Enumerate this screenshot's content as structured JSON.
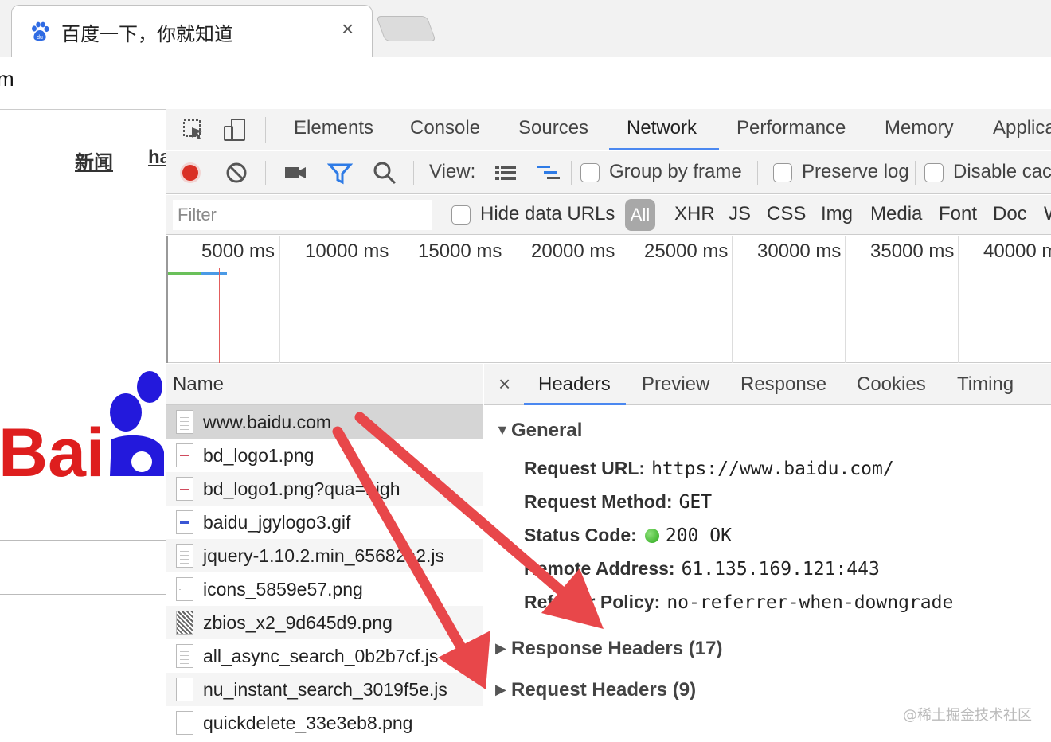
{
  "browser": {
    "tab_title": "百度一下，你就知道",
    "tab_close": "×",
    "address_text": "m"
  },
  "page": {
    "nav_news": "新闻",
    "nav_hao": "ha",
    "logo_text": "Bai"
  },
  "devtools": {
    "tabs": [
      "Elements",
      "Console",
      "Sources",
      "Network",
      "Performance",
      "Memory",
      "Applica"
    ],
    "active_tab": "Network",
    "toolbar": {
      "view_label": "View:",
      "group_by_frame": "Group by frame",
      "preserve_log": "Preserve log",
      "disable_cache": "Disable cac"
    },
    "filter": {
      "placeholder": "Filter",
      "hide_data_urls": "Hide data URLs",
      "types": [
        "All",
        "XHR",
        "JS",
        "CSS",
        "Img",
        "Media",
        "Font",
        "Doc",
        "W"
      ]
    },
    "timeline_ticks": [
      "5000 ms",
      "10000 ms",
      "15000 ms",
      "20000 ms",
      "25000 ms",
      "30000 ms",
      "35000 ms",
      "40000 m"
    ],
    "name_header": "Name",
    "requests": [
      "www.baidu.com",
      "bd_logo1.png",
      "bd_logo1.png?qua=high",
      "baidu_jgylogo3.gif",
      "jquery-1.10.2.min_65682a2.js",
      "icons_5859e57.png",
      "zbios_x2_9d645d9.png",
      "all_async_search_0b2b7cf.js",
      "nu_instant_search_3019f5e.js",
      "quickdelete_33e3eb8.png"
    ],
    "selected_request": "www.baidu.com",
    "detail": {
      "close": "×",
      "tabs": [
        "Headers",
        "Preview",
        "Response",
        "Cookies",
        "Timing"
      ],
      "active_tab": "Headers",
      "general_title": "General",
      "general": [
        {
          "key": "Request URL:",
          "value": "https://www.baidu.com/"
        },
        {
          "key": "Request Method:",
          "value": "GET"
        },
        {
          "key": "Status Code:",
          "value": "200 OK"
        },
        {
          "key": "Remote Address:",
          "value": "61.135.169.121:443"
        },
        {
          "key": "Referrer Policy:",
          "value": "no-referrer-when-downgrade"
        }
      ],
      "response_headers": "Response Headers (17)",
      "request_headers": "Request Headers (9)"
    }
  },
  "watermark": "@稀土掘金技术社区",
  "colors": {
    "accent": "#4b88f0",
    "record": "#d93025",
    "annotation_arrow": "#e8474a",
    "baidu_red": "#de1e1e",
    "baidu_blue": "#2319dc"
  }
}
